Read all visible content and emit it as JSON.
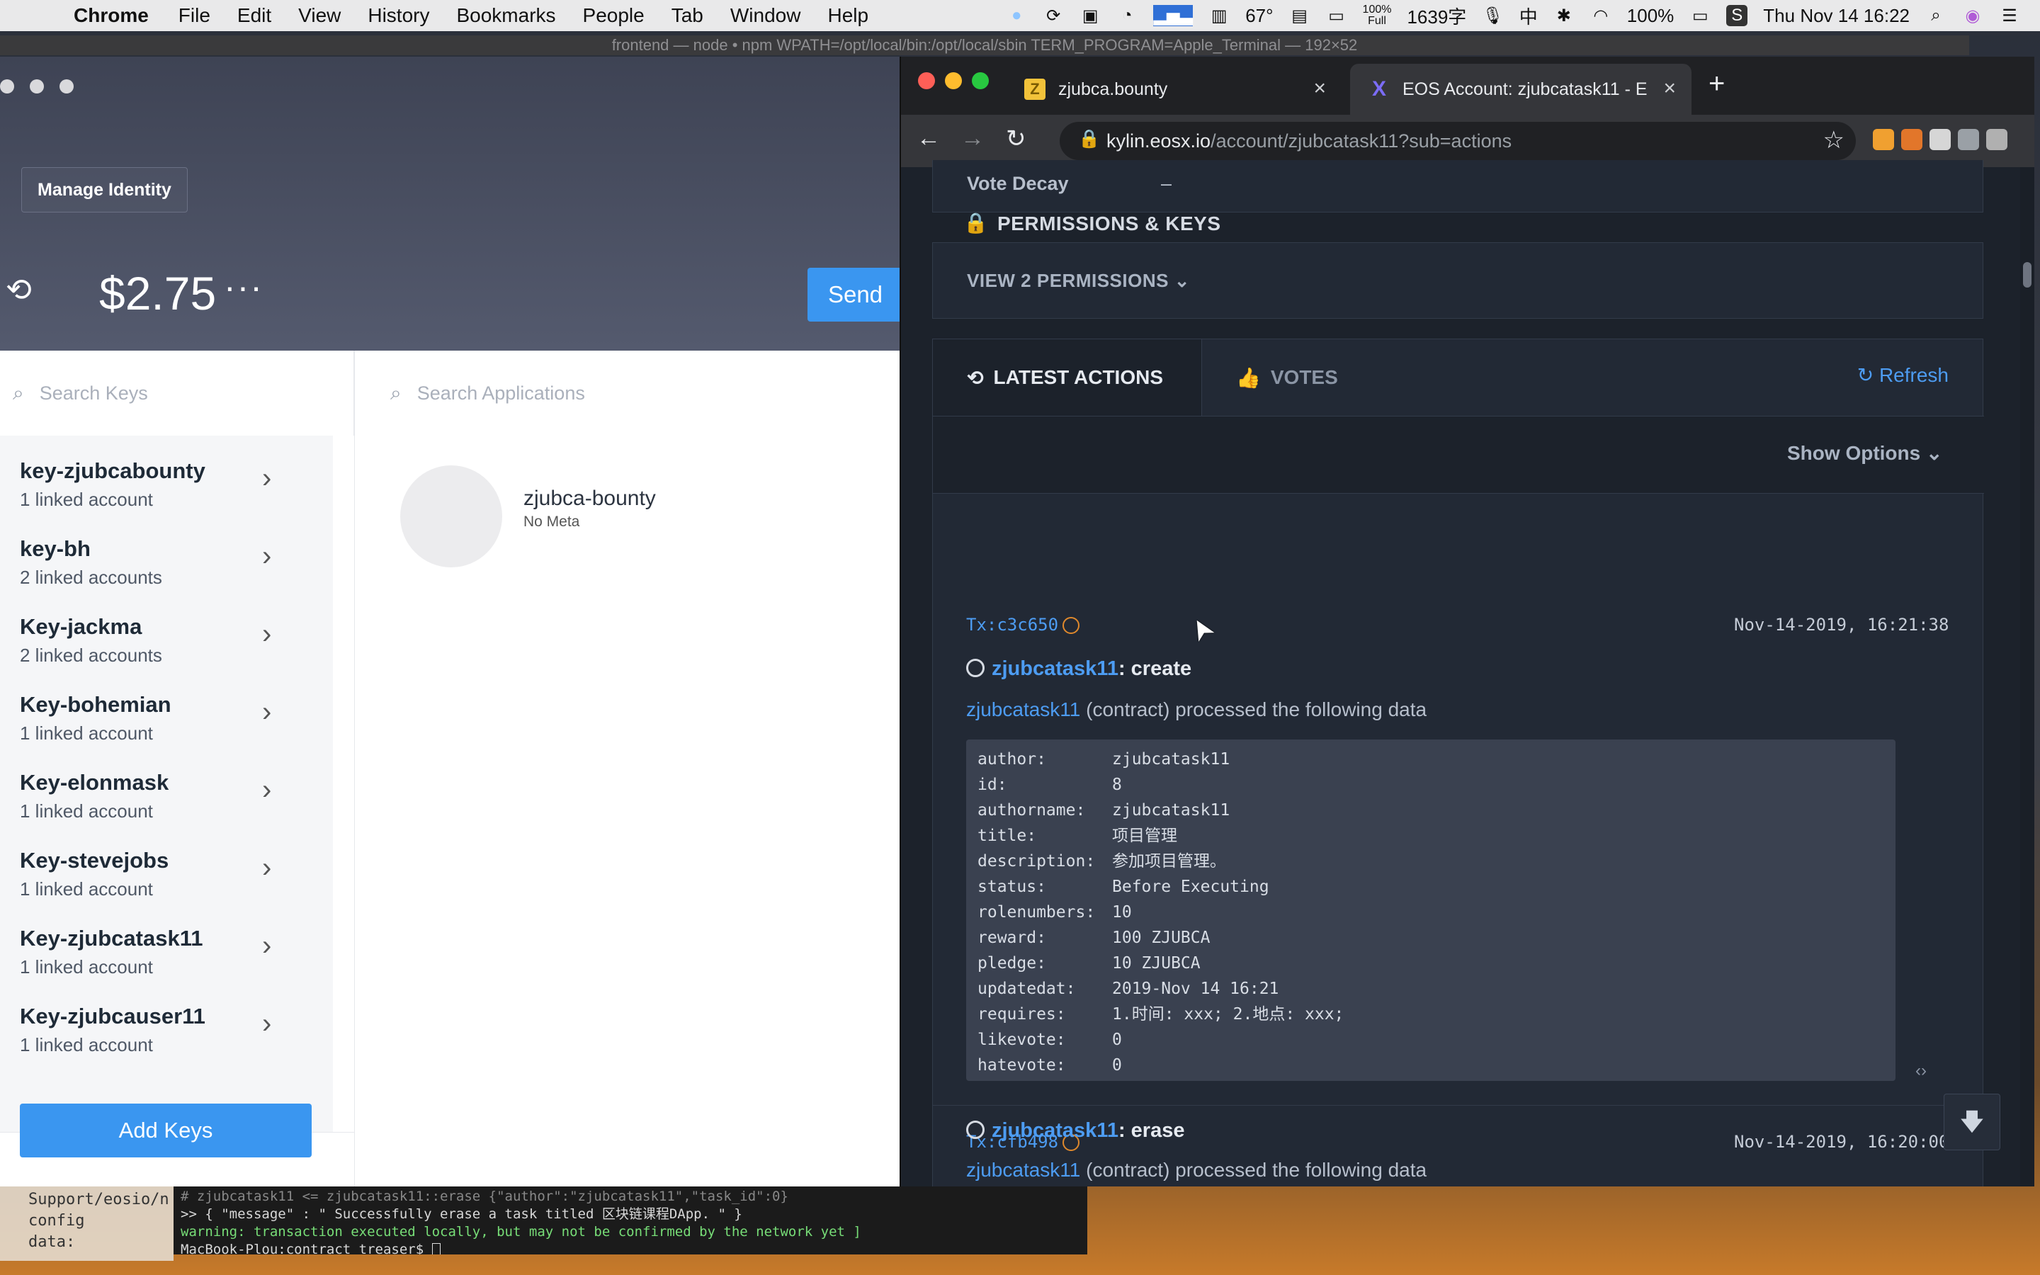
{
  "menubar": {
    "app": "Chrome",
    "items": [
      "File",
      "Edit",
      "View",
      "History",
      "Bookmarks",
      "People",
      "Tab",
      "Window",
      "Help"
    ],
    "temperature": "67°",
    "battery_small": "100%",
    "battery_small_sub": "Full",
    "word_count": "1639字",
    "input_method": "中",
    "battery": "100%",
    "datetime": "Thu Nov 14  16:22"
  },
  "terminal": {
    "title": "frontend — node • npm WPATH=/opt/local/bin:/opt/local/sbin TERM_PROGRAM=Apple_Terminal — 192×52",
    "left_lines": [
      "Support/eosio/n",
      "config",
      "   data:"
    ],
    "right_lines": [
      "#  zjubcatask11 <= zjubcatask11::erase           {\"author\":\"zjubcatask11\",\"task_id\":0}",
      ">> { \"message\" : \" Successfully erase a task titled 区块链课程DApp. \" }",
      "warning: transaction executed locally, but may not be confirmed by the network yet         ]",
      "MacBook-Plou:contract treaser$ "
    ]
  },
  "scatter": {
    "manage_identity": "Manage Identity",
    "balance": "$2.75",
    "balance_more": "···",
    "send": "Send",
    "search_keys_placeholder": "Search Keys",
    "search_apps_placeholder": "Search Applications",
    "keys": [
      {
        "name": "key-zjubcabounty",
        "linked": "1 linked account"
      },
      {
        "name": "key-bh",
        "linked": "2 linked accounts"
      },
      {
        "name": "Key-jackma",
        "linked": "2 linked accounts"
      },
      {
        "name": "Key-bohemian",
        "linked": "1 linked account"
      },
      {
        "name": "Key-elonmask",
        "linked": "1 linked account"
      },
      {
        "name": "Key-stevejobs",
        "linked": "1 linked account"
      },
      {
        "name": "Key-zjubcatask11",
        "linked": "1 linked account"
      },
      {
        "name": "Key-zjubcauser11",
        "linked": "1 linked account"
      }
    ],
    "add_keys": "Add Keys",
    "app": {
      "name": "zjubca-bounty",
      "meta": "No Meta"
    }
  },
  "chrome": {
    "tabs": [
      {
        "title": "zjubca.bounty",
        "fav_color": "#f2c23a",
        "fav_char": "Z"
      },
      {
        "title": "EOS Account: zjubcatask11 - E",
        "fav_color": "#202124",
        "fav_char": "X"
      }
    ],
    "url_host": "kylin.eosx.io",
    "url_path": "/account/zjubcatask11?sub=actions",
    "extension_colors": [
      "#9aa0a6",
      "#f0a030",
      "#e2762a",
      "#d6d6d6",
      "#9aa0a6",
      "#b0b0b0",
      "#e05050"
    ]
  },
  "page": {
    "vote_decay_label": "Vote Decay",
    "vote_decay_value": "–",
    "permissions_title": "PERMISSIONS & KEYS",
    "view_permissions": "VIEW 2 PERMISSIONS",
    "tab_latest": "LATEST ACTIONS",
    "tab_votes": "VOTES",
    "refresh": "Refresh",
    "show_options": "Show Options",
    "tx1": {
      "hash": "Tx:c3c650",
      "time": "Nov-14-2019, 16:21:38",
      "account": "zjubcatask11",
      "action": ": create",
      "desc_account": "zjubcatask11",
      "desc_rest": " (contract) processed the following data",
      "data": [
        {
          "k": "author:",
          "v": "zjubcatask11"
        },
        {
          "k": "id:",
          "v": "8"
        },
        {
          "k": "authorname:",
          "v": "zjubcatask11"
        },
        {
          "k": "title:",
          "v": "项目管理"
        },
        {
          "k": "description:",
          "v": "参加项目管理。"
        },
        {
          "k": "status:",
          "v": "Before Executing"
        },
        {
          "k": "rolenumbers:",
          "v": "10"
        },
        {
          "k": "reward:",
          "v": "100 ZJUBCA"
        },
        {
          "k": "pledge:",
          "v": "10 ZJUBCA"
        },
        {
          "k": "updatedat:",
          "v": "2019-Nov 14 16:21"
        },
        {
          "k": "requires:",
          "v": "1.时间: xxx; 2.地点: xxx;"
        },
        {
          "k": "likevote:",
          "v": "0"
        },
        {
          "k": "hatevote:",
          "v": "0"
        }
      ]
    },
    "tx2": {
      "hash": "Tx:cfb498",
      "time": "Nov-14-2019, 16:20:00",
      "account": "zjubcatask11",
      "action": ": erase",
      "desc_account": "zjubcatask11",
      "desc_rest": " (contract) processed the following data"
    }
  }
}
